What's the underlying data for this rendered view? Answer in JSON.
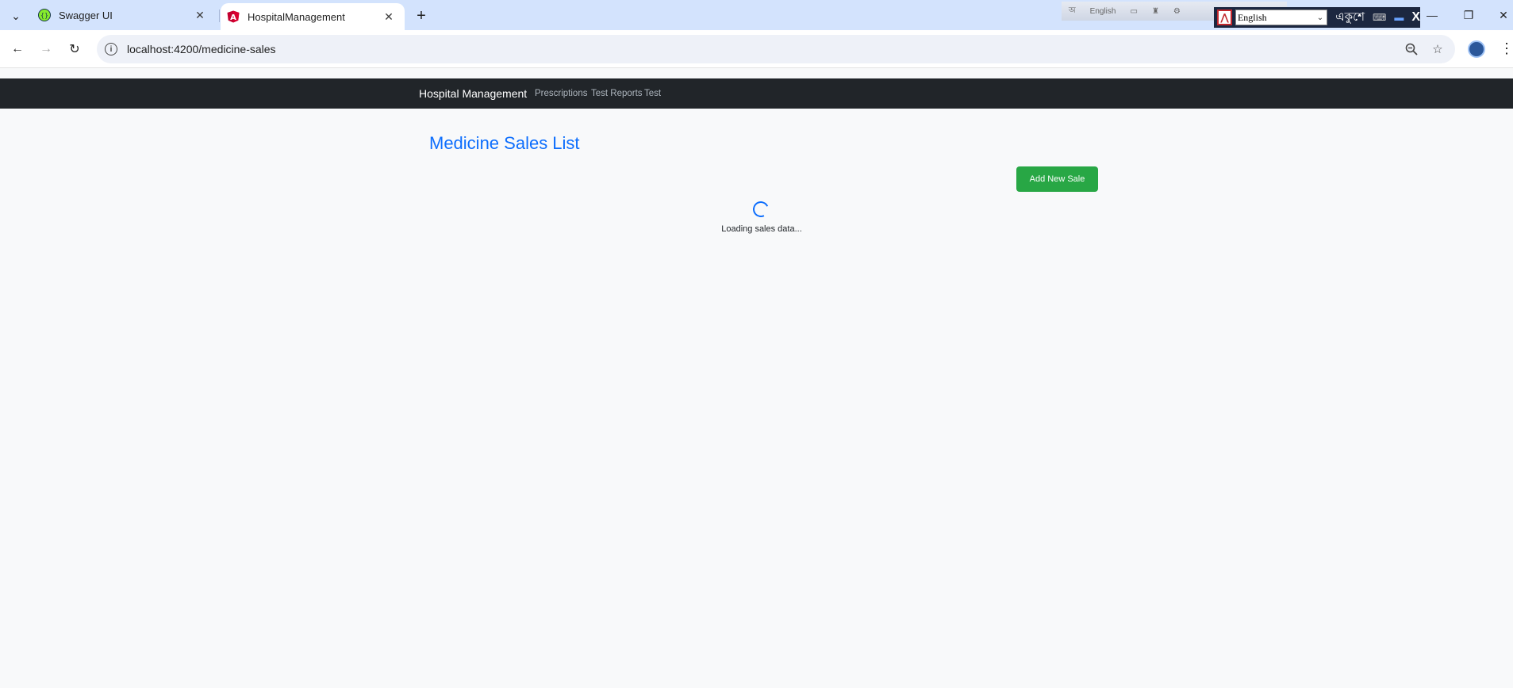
{
  "browser": {
    "tabs": [
      {
        "title": "Swagger UI",
        "active": false,
        "favicon": "swagger-icon"
      },
      {
        "title": "HospitalManagement",
        "active": true,
        "favicon": "angular-icon"
      }
    ],
    "url": "localhost:4200/medicine-sales",
    "ime": {
      "top_language": "English",
      "language_select": "English",
      "bangla_label": "একুশে"
    }
  },
  "app": {
    "navbar": {
      "brand": "Hospital Management",
      "links": [
        "Prescriptions",
        "Test Reports",
        "Test"
      ]
    },
    "page_title": "Medicine Sales List",
    "add_button": "Add New Sale",
    "loading_text": "Loading sales data..."
  },
  "colors": {
    "navbar_bg": "#212529",
    "title": "#0d6efd",
    "add_button": "#28a745",
    "page_bg": "#f8f9fa"
  }
}
